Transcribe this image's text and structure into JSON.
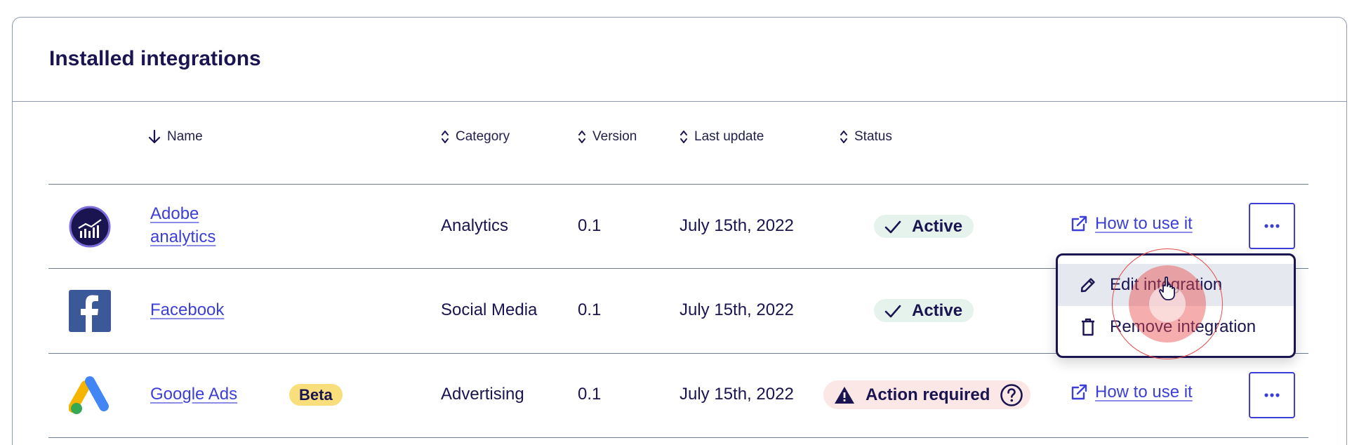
{
  "card": {
    "title": "Installed integrations"
  },
  "table": {
    "headers": [
      {
        "label": "Name",
        "sort": "descending"
      },
      {
        "label": "Category",
        "sort": "sortable"
      },
      {
        "label": "Version",
        "sort": "sortable"
      },
      {
        "label": "Last update",
        "sort": "sortable"
      },
      {
        "label": "Status",
        "sort": "sortable"
      }
    ],
    "rows": [
      {
        "name_line1": "Adobe",
        "name_line2": "analytics",
        "logo": "adobe-analytics-logo",
        "category": "Analytics",
        "version": "0.1",
        "last_update": "July 15th, 2022",
        "status": "Active",
        "action_link": "How to use it"
      },
      {
        "name": "Facebook",
        "logo": "facebook-logo",
        "category": "Social Media",
        "version": "0.1",
        "last_update": "July 15th, 2022",
        "status": "Active"
      },
      {
        "name": "Google Ads",
        "logo": "google-ads-logo",
        "badge": "Beta",
        "category": "Advertising",
        "version": "0.1",
        "last_update": "July 15th, 2022",
        "status": "Action required",
        "action_link": "How to use it"
      }
    ]
  },
  "menu": {
    "items": [
      {
        "label": "Edit integration",
        "icon": "pencil-icon",
        "state": "hovered"
      },
      {
        "label": "Remove integration",
        "icon": "trash-icon"
      }
    ]
  },
  "colors": {
    "primary": "#3c3fd6",
    "text": "#1a1450",
    "active_bg": "#e5f3ec",
    "warning_bg": "#fbe7e6",
    "beta_bg": "#f9de7c",
    "click_ring": "#e03a3a"
  }
}
